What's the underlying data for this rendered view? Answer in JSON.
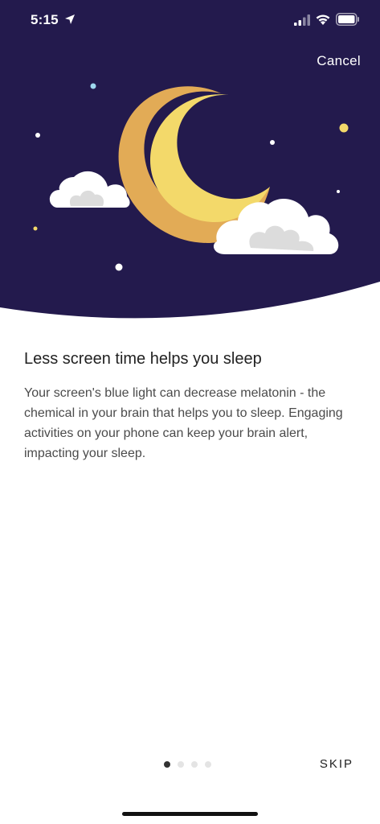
{
  "status_bar": {
    "time": "5:15",
    "icons": [
      "location-arrow-icon",
      "cellular-signal-icon",
      "wifi-icon",
      "battery-icon"
    ]
  },
  "header": {
    "cancel_label": "Cancel"
  },
  "illustration": {
    "icons": [
      "crescent-moon-icon",
      "cloud-icon",
      "star-icon"
    ],
    "colors": {
      "sky": "#231a4d",
      "moon_light": "#f3d96a",
      "moon_dark": "#e2ab56",
      "cloud": "#ffffff",
      "cloud_shadow": "#dcdcdc"
    }
  },
  "main": {
    "title": "Less screen time helps you sleep",
    "body": "Your screen's blue light can decrease melatonin - the chemical in your brain that helps you to sleep. Engaging activities on your phone can keep your brain alert, impacting your sleep."
  },
  "footer": {
    "page_count": 4,
    "active_page": 1,
    "skip_label": "SKIP"
  }
}
